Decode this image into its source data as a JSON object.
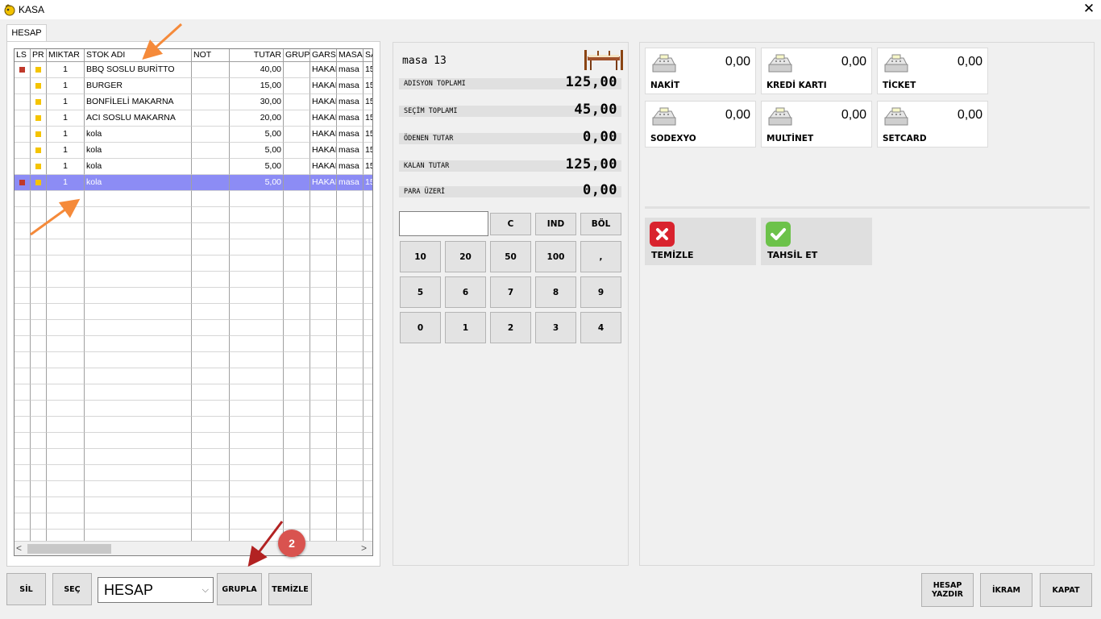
{
  "window": {
    "title": "KASA",
    "close_glyph": "✕"
  },
  "tab": {
    "label": "HESAP"
  },
  "grid": {
    "columns": [
      "LS",
      "PR",
      "MIKTAR",
      "STOK ADI",
      "NOT",
      "TUTAR",
      "GRUP",
      "GARS",
      "MASA",
      "SA"
    ],
    "rows": [
      {
        "ls": true,
        "miktar": "1",
        "stok": "BBQ SOSLU BURİTTO",
        "not": "",
        "tutar": "40,00",
        "grup": "",
        "gars": "HAKAI",
        "masa": "masa",
        "sa": "15"
      },
      {
        "ls": false,
        "miktar": "1",
        "stok": "BURGER",
        "not": "",
        "tutar": "15,00",
        "grup": "",
        "gars": "HAKAI",
        "masa": "masa",
        "sa": "15"
      },
      {
        "ls": false,
        "miktar": "1",
        "stok": "BONFİLELİ MAKARNA",
        "not": "",
        "tutar": "30,00",
        "grup": "",
        "gars": "HAKAI",
        "masa": "masa",
        "sa": "15"
      },
      {
        "ls": false,
        "miktar": "1",
        "stok": "ACI SOSLU MAKARNA",
        "not": "",
        "tutar": "20,00",
        "grup": "",
        "gars": "HAKAI",
        "masa": "masa",
        "sa": "15"
      },
      {
        "ls": false,
        "miktar": "1",
        "stok": "kola",
        "not": "",
        "tutar": "5,00",
        "grup": "",
        "gars": "HAKAI",
        "masa": "masa",
        "sa": "15"
      },
      {
        "ls": false,
        "miktar": "1",
        "stok": "kola",
        "not": "",
        "tutar": "5,00",
        "grup": "",
        "gars": "HAKAI",
        "masa": "masa",
        "sa": "15"
      },
      {
        "ls": false,
        "miktar": "1",
        "stok": "kola",
        "not": "",
        "tutar": "5,00",
        "grup": "",
        "gars": "HAKAI",
        "masa": "masa",
        "sa": "15"
      },
      {
        "ls": true,
        "miktar": "1",
        "stok": "kola",
        "not": "",
        "tutar": "5,00",
        "grup": "",
        "gars": "HAKAI",
        "masa": "masa",
        "sa": "15",
        "selected": true
      }
    ],
    "scroll_left": "<",
    "scroll_right": ">"
  },
  "summary": {
    "table_name": "masa 13",
    "lines": [
      {
        "label": "ADISYON TOPLAMI",
        "value": "125,00"
      },
      {
        "label": "SEÇİM TOPLAMI",
        "value": "45,00"
      },
      {
        "label": "ÖDENEN TUTAR",
        "value": "0,00"
      },
      {
        "label": "KALAN TUTAR",
        "value": "125,00"
      },
      {
        "label": "PARA ÜZERİ",
        "value": "0,00"
      }
    ]
  },
  "keypad": {
    "input_value": "",
    "row0": [
      "C",
      "IND",
      "BÖL"
    ],
    "row1": [
      "10",
      "20",
      "50",
      "100",
      ","
    ],
    "row2": [
      "5",
      "6",
      "7",
      "8",
      "9"
    ],
    "row3": [
      "0",
      "1",
      "2",
      "3",
      "4"
    ]
  },
  "payments": [
    {
      "label": "NAKİT",
      "value": "0,00"
    },
    {
      "label": "KREDİ KARTI",
      "value": "0,00"
    },
    {
      "label": "TİCKET",
      "value": "0,00"
    },
    {
      "label": "SODEXYO",
      "value": "0,00"
    },
    {
      "label": "MULTİNET",
      "value": "0,00"
    },
    {
      "label": "SETCARD",
      "value": "0,00"
    }
  ],
  "actions": {
    "clear_label": "TEMİZLE",
    "collect_label": "TAHSİL ET"
  },
  "bottom": {
    "sil": "SİL",
    "sec": "SEÇ",
    "combo_value": "HESAP",
    "combo_arrow": "⌵",
    "grupla": "GRUPLA",
    "temizle": "TEMİZLE",
    "hesap_yazdir": "HESAP YAZDIR",
    "ikram": "İKRAM",
    "kapat": "KAPAT"
  },
  "annotation": {
    "badge": "2",
    "arrow_color": "#f58a3a",
    "dark_arrow_color": "#b22222"
  },
  "colors": {
    "selection": "#8c8cf5",
    "ls_marker": "#c0392b",
    "pr_marker": "#f5c400"
  },
  "icons": {
    "window": "app-icon",
    "payment": "cash-register-icon",
    "clear": "x-icon",
    "collect": "check-icon",
    "table": "dining-table-icon"
  }
}
